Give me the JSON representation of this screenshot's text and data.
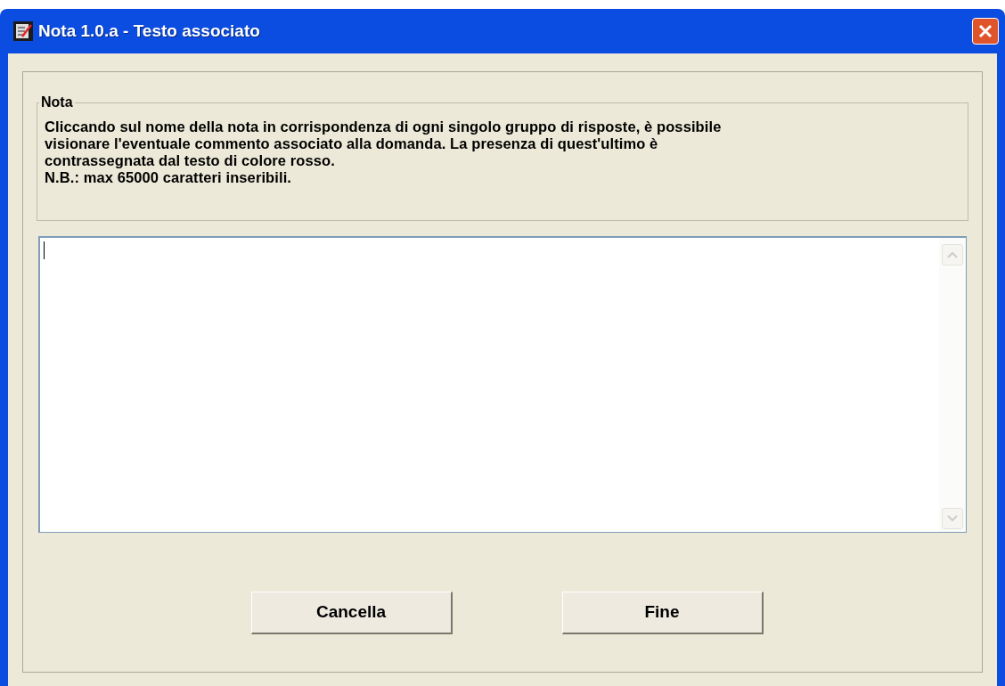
{
  "window": {
    "title": "Nota 1.0.a - Testo associato"
  },
  "group": {
    "title": "Nota",
    "text": "Cliccando sul nome della nota in corrispondenza di ogni singolo gruppo di risposte, è possibile\nvisionare l'eventuale commento associato alla domanda. La presenza di quest'ultimo è\ncontrassegnata dal testo di colore rosso.\nN.B.: max 65000 caratteri inseribili."
  },
  "buttons": [
    "Cancella",
    "Fine"
  ]
}
